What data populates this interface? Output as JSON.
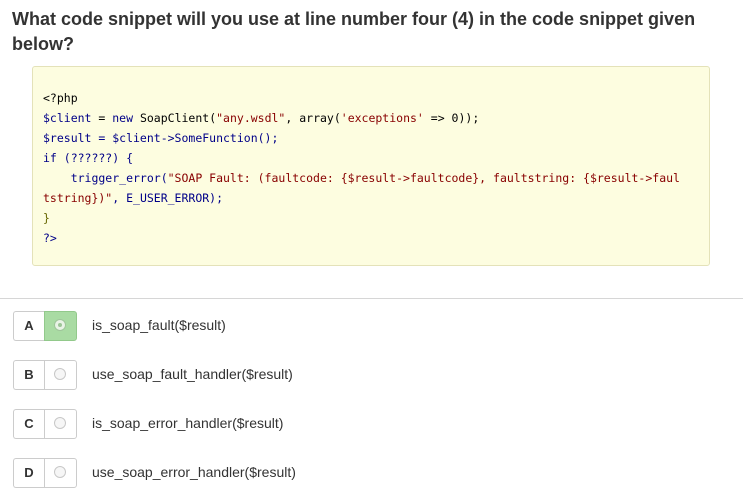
{
  "question": {
    "text": "What code snippet will you use at line number four (4) in the code snippet given below?"
  },
  "code": {
    "line1": "<?php",
    "line2_var": "$client",
    "line2_rest_a": " = ",
    "line2_kw": "new",
    "line2_rest_b": " SoapClient(",
    "line2_str1": "\"any.wsdl\"",
    "line2_rest_c": ", array(",
    "line2_str2": "'exceptions'",
    "line2_rest_d": " => 0));",
    "line3": "$result = $client->SomeFunction();",
    "line4": "if (??????) {",
    "line5_a": "    trigger_error(",
    "line5_str": "\"SOAP Fault: (faultcode: {$result->faultcode}, faultstring: {$result->faul",
    "line6_str": "tstring})\"",
    "line6_rest": ", E_USER_ERROR);",
    "line7": "}",
    "line8": "?>"
  },
  "options": [
    {
      "letter": "A",
      "text": "is_soap_fault($result)",
      "selected": true
    },
    {
      "letter": "B",
      "text": "use_soap_fault_handler($result)",
      "selected": false
    },
    {
      "letter": "C",
      "text": "is_soap_error_handler($result)",
      "selected": false
    },
    {
      "letter": "D",
      "text": "use_soap_error_handler($result)",
      "selected": false
    }
  ],
  "colors": {
    "code_background": "#fdfde0",
    "selected_accent": "#a9dba3"
  }
}
